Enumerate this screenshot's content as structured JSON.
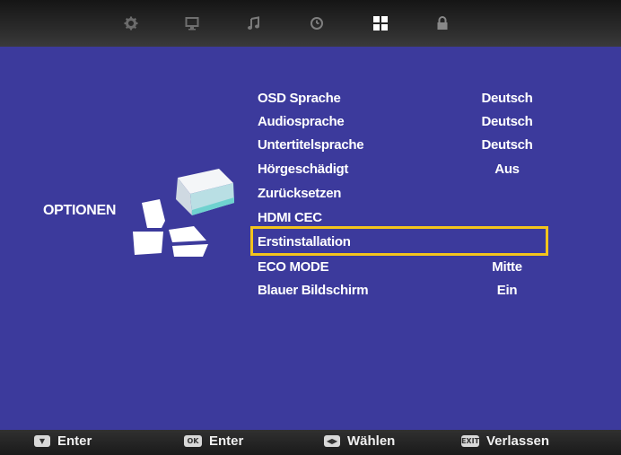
{
  "tabs": [
    {
      "icon": "gear-icon",
      "active": false
    },
    {
      "icon": "monitor-icon",
      "active": false
    },
    {
      "icon": "music-note-icon",
      "active": false
    },
    {
      "icon": "clock-icon",
      "active": false
    },
    {
      "icon": "options-grid-icon",
      "active": true
    },
    {
      "icon": "lock-icon",
      "active": false
    }
  ],
  "menu": {
    "title": "OPTIONEN"
  },
  "options": [
    {
      "label": "OSD Sprache",
      "value": "Deutsch"
    },
    {
      "label": "Audiosprache",
      "value": "Deutsch"
    },
    {
      "label": "Untertitelsprache",
      "value": "Deutsch"
    },
    {
      "label": "Hörgeschädigt",
      "value": "Aus"
    },
    {
      "label": "Zurücksetzen",
      "value": ""
    },
    {
      "label": "HDMI CEC",
      "value": ""
    },
    {
      "label": "Erstinstallation",
      "value": ""
    },
    {
      "label": "ECO MODE",
      "value": "Mitte"
    },
    {
      "label": "Blauer Bildschirm",
      "value": "Ein"
    }
  ],
  "selected_option": "Erstinstallation",
  "help": {
    "down_key": "▼",
    "enter1": "Enter",
    "ok_key": "OK",
    "enter2": "Enter",
    "lr_key": "◀▶",
    "select": "Wählen",
    "exit_key": "EXIT",
    "exit": "Verlassen"
  },
  "colors": {
    "background": "#3c3a9c",
    "highlight": "#f3c41c",
    "tabbar": "#222222"
  }
}
